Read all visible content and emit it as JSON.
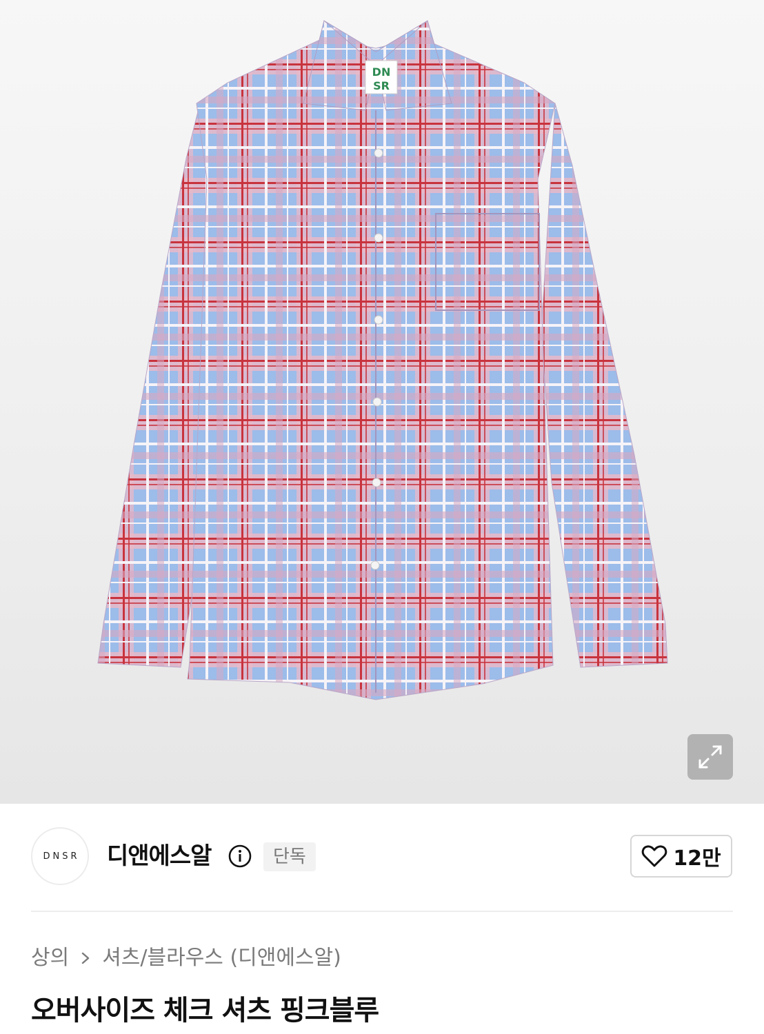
{
  "hero": {
    "image_description": "Oversized plaid shirt in light blue with pink and red checks",
    "label_text": [
      "DN",
      "SR"
    ],
    "expand_icon": "expand-icon"
  },
  "brand": {
    "logo_text": "DNSR",
    "name": "디앤에스알",
    "info_icon": "info-icon",
    "badge": "단독"
  },
  "like": {
    "icon": "heart-icon",
    "count": "12만"
  },
  "breadcrumb": {
    "category": "상의",
    "separator_icon": "chevron-right-icon",
    "subcategory": "셔츠/블라우스 (디앤에스알)"
  },
  "product": {
    "title": "오버사이즈 체크 셔츠 핑크블루"
  },
  "colors": {
    "shirt_base": "#9cbcea",
    "check_pink": "#e8b3c3",
    "check_red": "#c8333d",
    "check_white": "#f6f3f7",
    "label_green": "#2e8a52"
  }
}
